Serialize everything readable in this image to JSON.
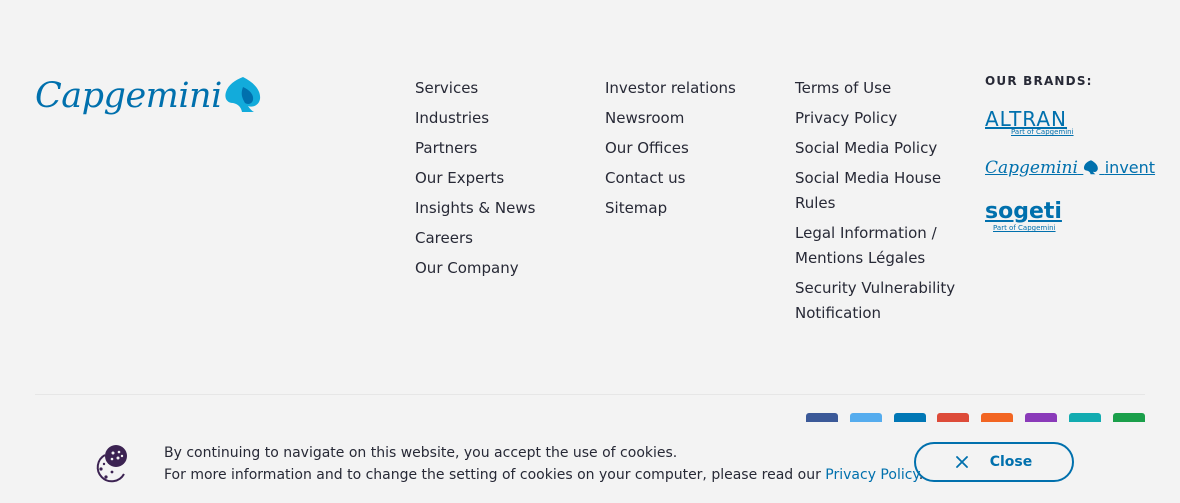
{
  "logo": {
    "text": "Capgemini"
  },
  "columns": [
    {
      "links": [
        "Services",
        "Industries",
        "Partners",
        "Our Experts",
        "Insights & News",
        "Careers",
        "Our Company"
      ]
    },
    {
      "links": [
        "Investor relations",
        "Newsroom",
        "Our Offices",
        "Contact us",
        "Sitemap"
      ]
    },
    {
      "links": [
        "Terms of Use",
        "Privacy Policy",
        "Social Media Policy",
        "Social Media House Rules",
        "Legal Information / Mentions Légales",
        "Security Vulnerability Notification"
      ]
    }
  ],
  "brands": {
    "title": "OUR BRANDS:",
    "altran": {
      "name": "ALTRAN",
      "sub": "Part of Capgemini"
    },
    "invent": {
      "name": "Capgemini",
      "suffix": "invent"
    },
    "sogeti": {
      "name": "sogeti",
      "sub": "Part of Capgemini"
    }
  },
  "social_colors": [
    "#3b5998",
    "#55acee",
    "#0077b5",
    "#dd4b39",
    "#f26522",
    "#8a3ab9",
    "#12abb0",
    "#1a9f4a"
  ],
  "cookie": {
    "line1": "By continuing to navigate on this website, you accept the use of cookies.",
    "line2": "For more information and to change the setting of cookies on your computer, please read our",
    "link": "Privacy Policy",
    "period": ".",
    "close_label": "Close"
  },
  "colors": {
    "brand_blue": "#0070ad",
    "text": "#272936",
    "cookie_icon": "#3c2352"
  }
}
